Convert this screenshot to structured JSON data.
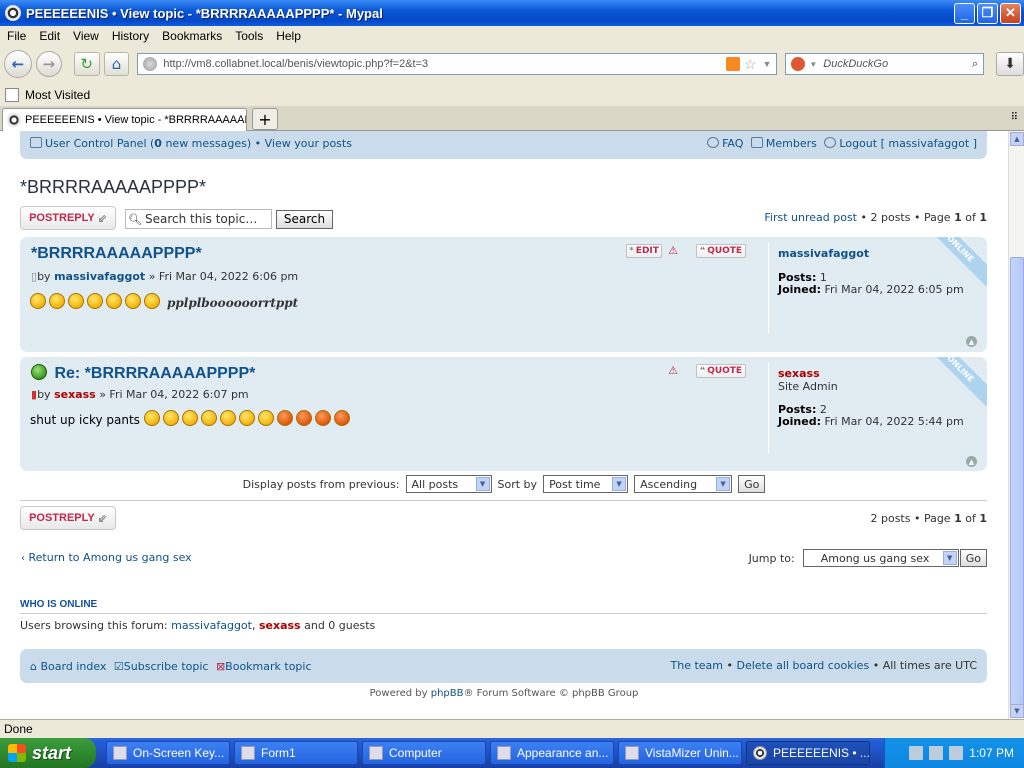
{
  "window": {
    "title": "PEEEEEENIS • View topic - *BRRRRAAAAAPPPP* - Mypal",
    "minimize": "_",
    "maximize": "❐",
    "close": "✕"
  },
  "menu": [
    "File",
    "Edit",
    "View",
    "History",
    "Bookmarks",
    "Tools",
    "Help"
  ],
  "nav": {
    "url": "http://vm8.collabnet.local/benis/viewtopic.php?f=2&t=3",
    "search_placeholder": "DuckDuckGo"
  },
  "bookmarks": {
    "most_visited": "Most Visited"
  },
  "tab": {
    "label": "PEEEEEENIS • View topic - *BRRRRAAAAAP...",
    "new_tab": "+"
  },
  "forum": {
    "navbar": {
      "ucp_pre": "User Control Panel (",
      "ucp_count": "0",
      "ucp_post": " new messages)",
      "sep": "•",
      "view_posts": "View your posts",
      "faq": "FAQ",
      "members": "Members",
      "logout": "Logout [ massivafaggot ]"
    },
    "topic_title": "*BRRRRAAAAAPPPP*",
    "postreply": "POSTREPLY",
    "search_placeholder": "Search this topic…",
    "search_button": "Search",
    "pagination_top": "First unread post • 2 posts • Page 1 of 1",
    "pagination_bottom": "2 posts • Page 1 of 1",
    "posts": [
      {
        "title": "*BRRRRAAAAAPPPP*",
        "author_prefix": "by",
        "author": "massivafaggot",
        "date": "» Fri Mar 04, 2022 6:06 pm",
        "body_text": "pplplboooooorrtppt",
        "smilies": 7,
        "buttons": {
          "edit": "EDIT",
          "quote": "QUOTE"
        },
        "profile": {
          "username": "massivafaggot",
          "rank": "",
          "posts_label": "Posts:",
          "posts": "1",
          "joined_label": "Joined:",
          "joined": "Fri Mar 04, 2022 6:05 pm"
        },
        "online": "ONLINE"
      },
      {
        "title": "Re: *BRRRRAAAAAPPPP*",
        "author_prefix": "by",
        "author": "sexass",
        "date": "» Fri Mar 04, 2022 6:07 pm",
        "body_text": "shut up icky pants",
        "smilies": 11,
        "buttons": {
          "quote": "QUOTE"
        },
        "profile": {
          "username": "sexass",
          "rank": "Site Admin",
          "posts_label": "Posts:",
          "posts": "2",
          "joined_label": "Joined:",
          "joined": "Fri Mar 04, 2022 5:44 pm"
        },
        "online": "ONLINE"
      }
    ],
    "sort": {
      "display_label": "Display posts from previous:",
      "display_value": "All posts",
      "sortby_label": "Sort by",
      "sortby_value": "Post time",
      "order_value": "Ascending",
      "go": "Go"
    },
    "return_link": "Return to Among us gang sex",
    "jump": {
      "label": "Jump to:",
      "value": "Among us gang sex",
      "go": "Go"
    },
    "who_online": {
      "heading": "WHO IS ONLINE",
      "text_pre": "Users browsing this forum: ",
      "user1": "massivafaggot",
      "comma": ",",
      "user2": "sexass",
      "text_post": "and 0 guests"
    },
    "footer": {
      "board_index": "Board index",
      "subscribe": "Subscribe topic",
      "bookmark": "Bookmark topic",
      "team": "The team",
      "delete_cookies": "Delete all board cookies",
      "timezone": "All times are UTC",
      "sep": "•"
    },
    "powered_pre": "Powered by ",
    "powered_link": "phpBB",
    "powered_post": "® Forum Software © phpBB Group"
  },
  "status": "Done",
  "taskbar": {
    "start": "start",
    "tasks": [
      "On-Screen Key...",
      "Form1",
      "Computer",
      "Appearance an...",
      "VistaMizer Unin...",
      "PEEEEEENIS • ..."
    ],
    "clock": "1:07 PM"
  },
  "colors": {
    "forum_blue": "#105289",
    "admin_red": "#aa0000",
    "panel_bg": "#cadceb",
    "post_bg": "#e1ebf2"
  }
}
